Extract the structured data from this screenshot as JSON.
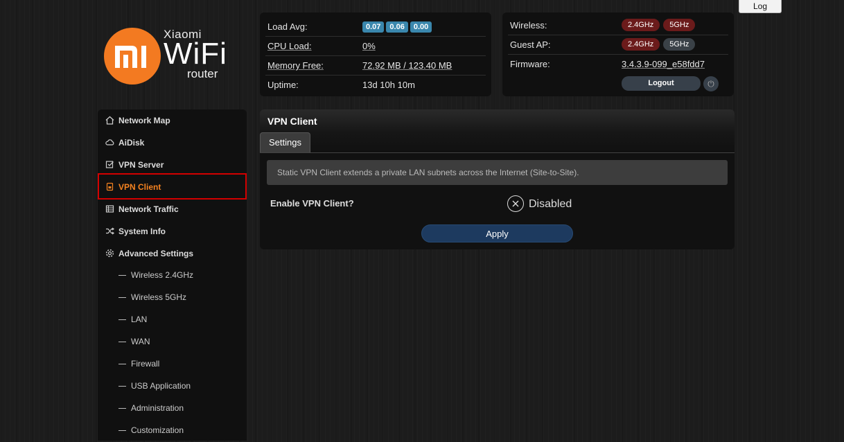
{
  "header": {
    "log_label": "Log",
    "logo": {
      "brand_top": "Xiaomi",
      "brand_main": "WiFi",
      "brand_bottom": "router",
      "accent": "#f37a21"
    }
  },
  "status_left": {
    "rows": [
      {
        "label": "Load Avg:",
        "values": [
          "0.07",
          "0.06",
          "0.00"
        ]
      },
      {
        "label": "CPU Load:",
        "value": "0%"
      },
      {
        "label": "Memory Free:",
        "value": "72.92 MB / 123.40 MB"
      },
      {
        "label": "Uptime:",
        "value": "13d 10h 10m"
      }
    ]
  },
  "status_right": {
    "wireless": {
      "label": "Wireless:",
      "band_24": "2.4GHz",
      "band_5": "5GHz"
    },
    "guest_ap": {
      "label": "Guest AP:",
      "band_24": "2.4GHz",
      "band_5": "5GHz"
    },
    "firmware": {
      "label": "Firmware:",
      "value": "3.4.3.9-099_e58fdd7"
    },
    "logout_label": "Logout",
    "power_icon": "power-icon"
  },
  "sidebar": {
    "items": [
      {
        "label": "Network Map",
        "icon": "home-icon"
      },
      {
        "label": "AiDisk",
        "icon": "cloud-icon"
      },
      {
        "label": "VPN Server",
        "icon": "vpn-server-icon"
      },
      {
        "label": "VPN Client",
        "icon": "vpn-client-icon",
        "active": true
      },
      {
        "label": "Network Traffic",
        "icon": "traffic-icon"
      },
      {
        "label": "System Info",
        "icon": "shuffle-icon"
      },
      {
        "label": "Advanced Settings",
        "icon": "gear-icon"
      }
    ],
    "sub_items": [
      "Wireless 2.4GHz",
      "Wireless 5GHz",
      "LAN",
      "WAN",
      "Firewall",
      "USB Application",
      "Administration",
      "Customization"
    ],
    "active_color": "#f58220"
  },
  "main": {
    "title": "VPN Client",
    "tabs": [
      {
        "label": "Settings"
      }
    ],
    "info_text": "Static VPN Client extends a private LAN subnets across the Internet (Site-to-Site).",
    "enable_label": "Enable VPN Client?",
    "enable_state": "Disabled",
    "apply_label": "Apply"
  }
}
